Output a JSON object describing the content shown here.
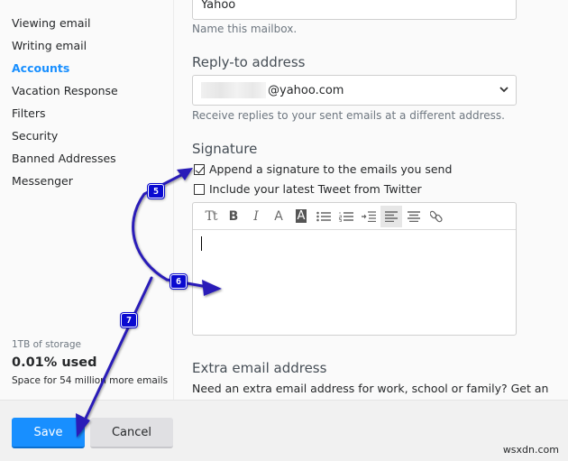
{
  "sidebar": {
    "items": [
      {
        "label": "Viewing email",
        "active": false
      },
      {
        "label": "Writing email",
        "active": false
      },
      {
        "label": "Accounts",
        "active": true
      },
      {
        "label": "Vacation Response",
        "active": false
      },
      {
        "label": "Filters",
        "active": false
      },
      {
        "label": "Security",
        "active": false
      },
      {
        "label": "Banned Addresses",
        "active": false
      },
      {
        "label": "Messenger",
        "active": false
      }
    ],
    "storage": {
      "capacity": "1TB of storage",
      "used": "0.01% used",
      "space": "Space for 54 million more emails"
    }
  },
  "main": {
    "mailbox_name": {
      "value": "Yahoo",
      "hint": "Name this mailbox."
    },
    "reply_to": {
      "title": "Reply-to address",
      "value_suffix": "@yahoo.com",
      "hint": "Receive replies to your sent emails at a different address."
    },
    "signature": {
      "title": "Signature",
      "append_label": "Append a signature to the emails you send",
      "append_checked": true,
      "tweet_label": "Include your latest Tweet from Twitter",
      "tweet_checked": false,
      "toolbar": [
        {
          "name": "font-size-icon",
          "glyph": "Tt"
        },
        {
          "name": "bold-icon",
          "glyph": "B"
        },
        {
          "name": "italic-icon",
          "glyph": "I"
        },
        {
          "name": "text-color-icon",
          "glyph": "A"
        },
        {
          "name": "highlight-color-icon",
          "glyph": "A"
        },
        {
          "name": "bulleted-list-icon",
          "glyph": ""
        },
        {
          "name": "numbered-list-icon",
          "glyph": ""
        },
        {
          "name": "indent-icon",
          "glyph": ""
        },
        {
          "name": "align-left-icon",
          "glyph": ""
        },
        {
          "name": "align-center-icon",
          "glyph": ""
        },
        {
          "name": "link-icon",
          "glyph": ""
        }
      ],
      "body": ""
    },
    "extra_email": {
      "title": "Extra email address",
      "text": "Need an extra email address for work, school or family? Get an"
    }
  },
  "footer": {
    "save_label": "Save",
    "cancel_label": "Cancel",
    "watermark": "wsxdn.com"
  },
  "annotations": {
    "badges": [
      "5",
      "6",
      "7"
    ],
    "color": "#2a1fb8"
  }
}
